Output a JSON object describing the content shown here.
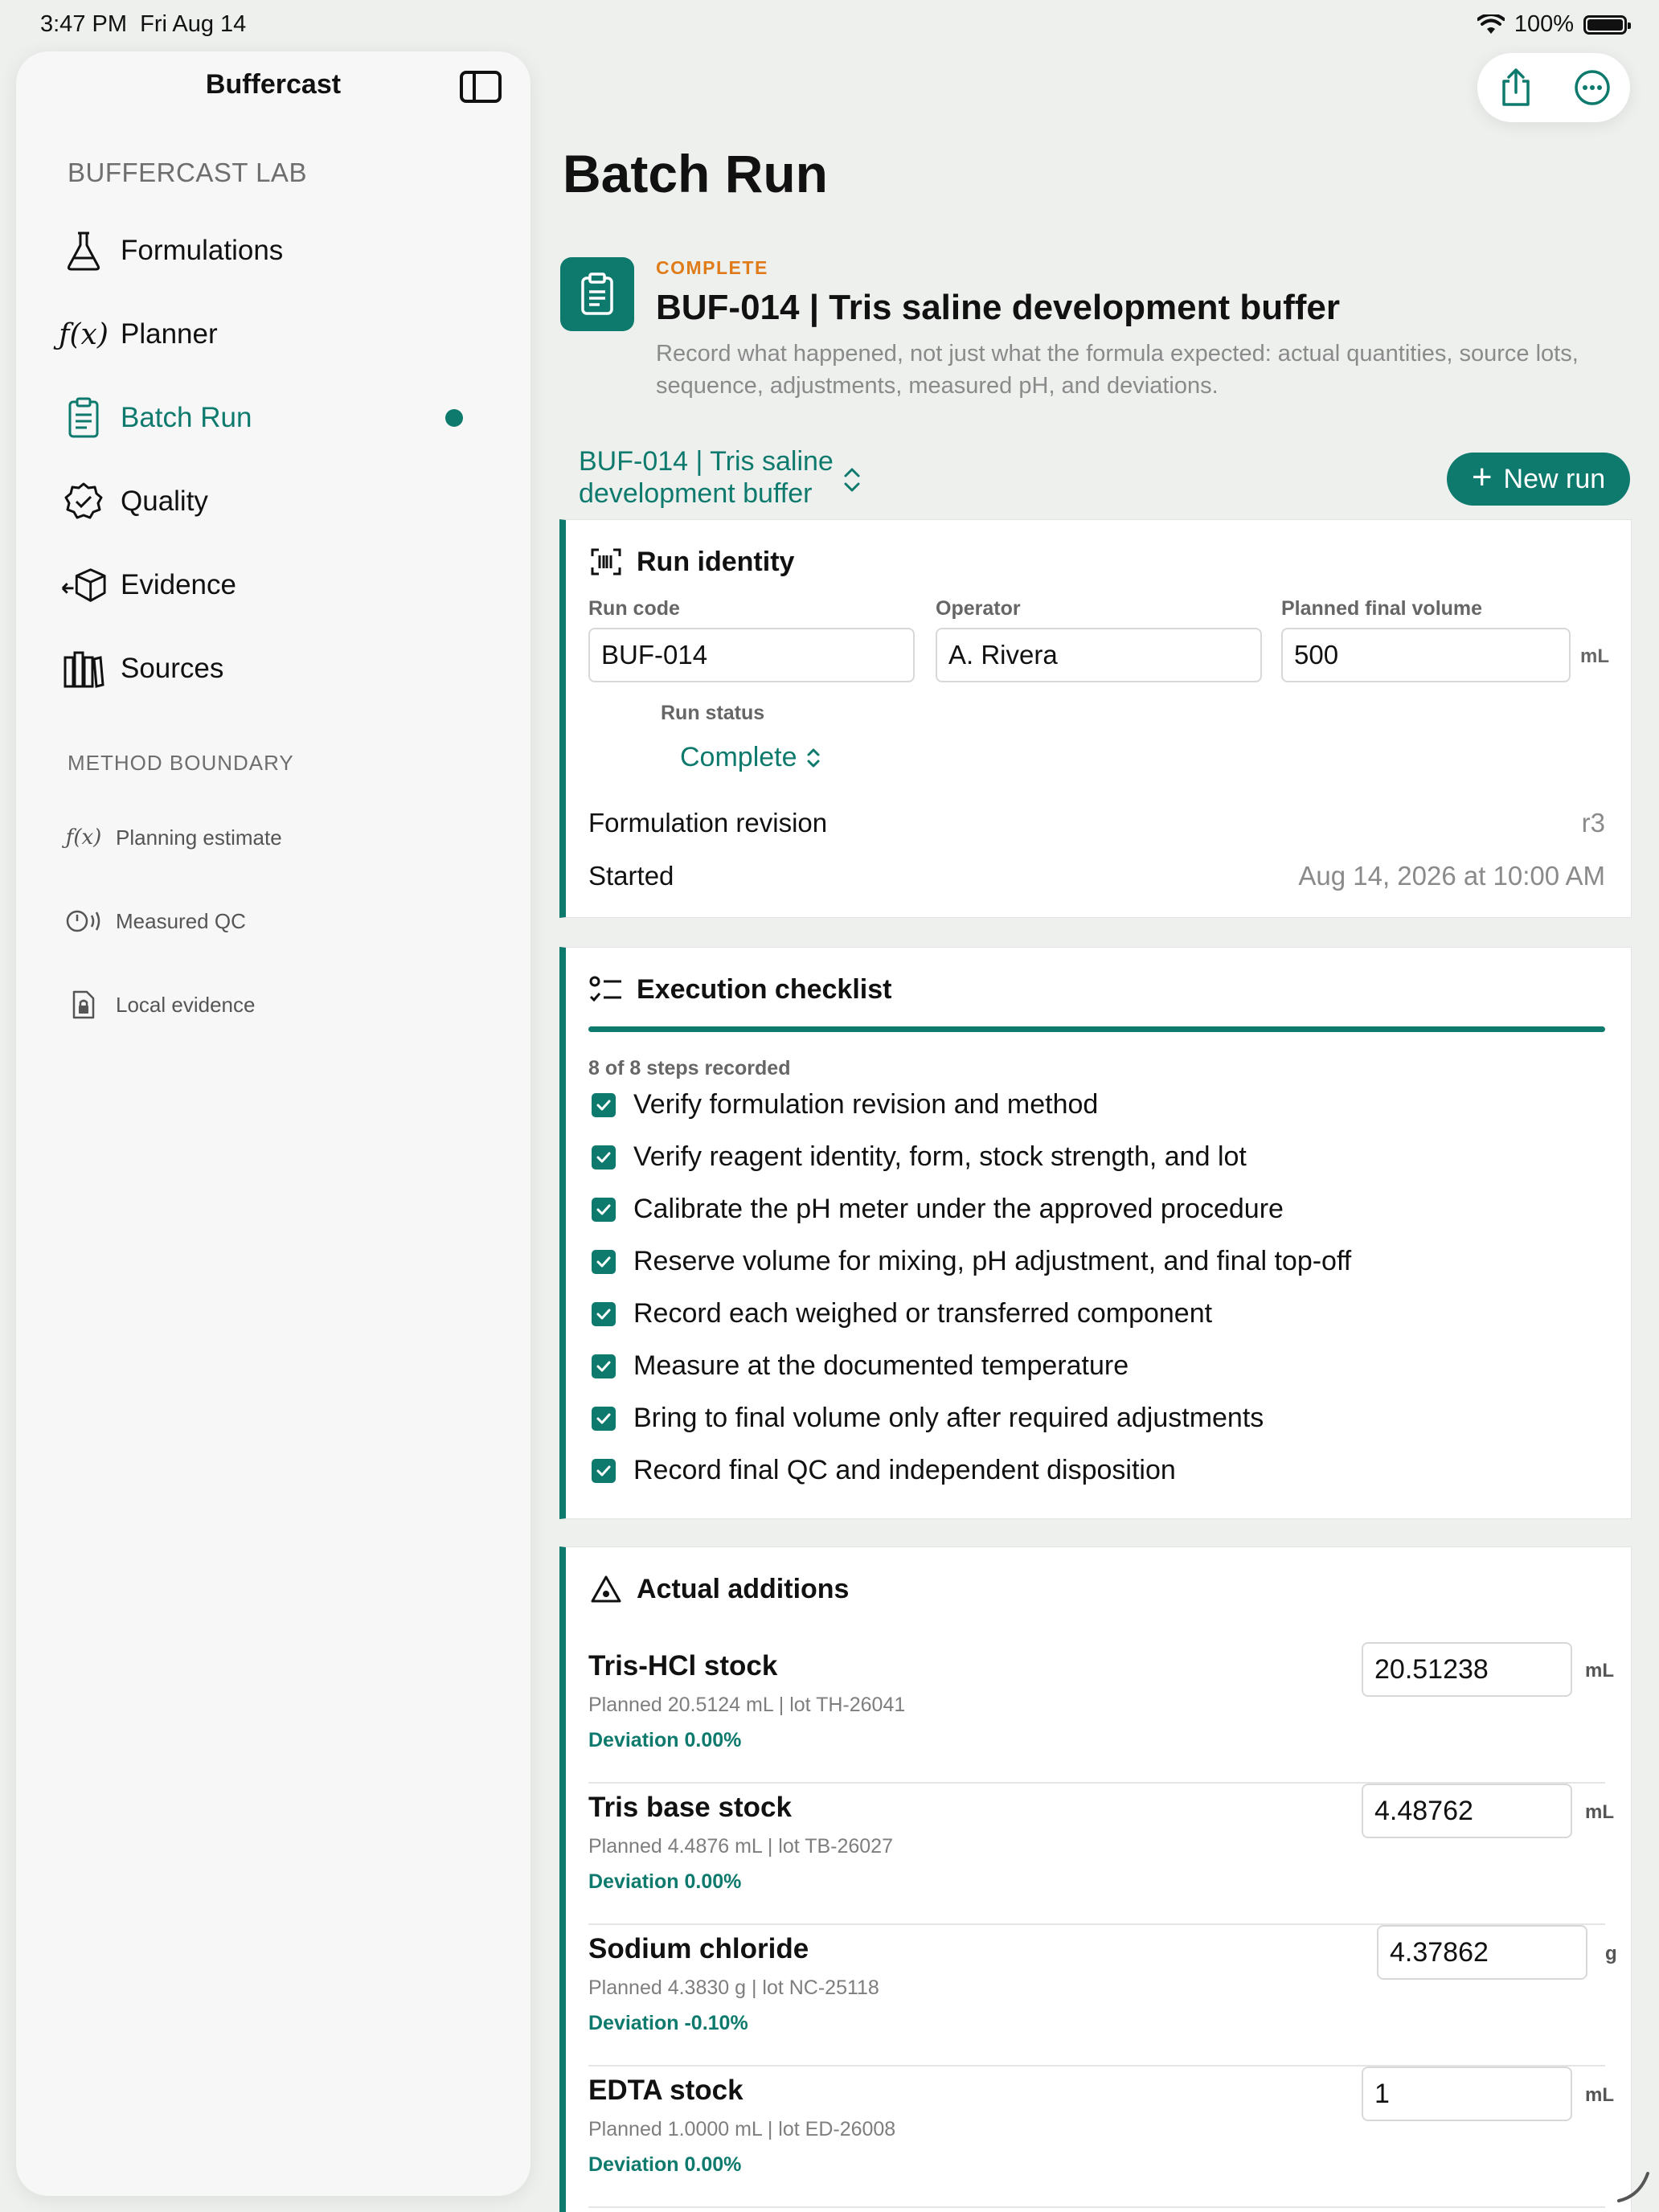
{
  "status_bar": {
    "time": "3:47 PM",
    "date": "Fri Aug 14",
    "battery": "100%"
  },
  "sidebar": {
    "title": "Buffercast",
    "section": "BUFFERCAST LAB",
    "items": [
      {
        "label": "Formulations",
        "icon": "flask-icon"
      },
      {
        "label": "Planner",
        "icon": "function-icon"
      },
      {
        "label": "Batch Run",
        "icon": "clipboard-icon",
        "active": true
      },
      {
        "label": "Quality",
        "icon": "seal-check-icon"
      },
      {
        "label": "Evidence",
        "icon": "box-icon"
      },
      {
        "label": "Sources",
        "icon": "books-icon"
      }
    ],
    "boundary_section": "METHOD BOUNDARY",
    "boundary_items": [
      {
        "label": "Planning estimate",
        "icon": "function-icon"
      },
      {
        "label": "Measured QC",
        "icon": "gauge-icon"
      },
      {
        "label": "Local evidence",
        "icon": "locked-doc-icon"
      }
    ]
  },
  "page": {
    "title": "Batch Run",
    "status": "COMPLETE",
    "name": "BUF-014 | Tris saline development buffer",
    "description": "Record what happened, not just what the formula expected: actual quantities, source lots, sequence, adjustments, measured pH, and deviations.",
    "picker_label": "BUF-014 | Tris saline development buffer",
    "new_run_label": "New run"
  },
  "run_identity": {
    "title": "Run identity",
    "run_code_label": "Run code",
    "run_code": "BUF-014",
    "operator_label": "Operator",
    "operator": "A. Rivera",
    "volume_label": "Planned final volume",
    "volume": "500",
    "volume_unit": "mL",
    "status_label": "Run status",
    "status_value": "Complete",
    "revision_label": "Formulation revision",
    "revision_value": "r3",
    "started_label": "Started",
    "started_value": "Aug 14, 2026 at 10:00 AM"
  },
  "checklist": {
    "title": "Execution checklist",
    "count_text": "8 of 8 steps recorded",
    "progress": 1.0,
    "steps": [
      "Verify formulation revision and method",
      "Verify reagent identity, form, stock strength, and lot",
      "Calibrate the pH meter under the approved procedure",
      "Reserve volume for mixing, pH adjustment, and final top-off",
      "Record each weighed or transferred component",
      "Measure at the documented temperature",
      "Bring to final volume only after required adjustments",
      "Record final QC and independent disposition"
    ]
  },
  "additions": {
    "title": "Actual additions",
    "rows": [
      {
        "name": "Tris-HCl stock",
        "planned": "Planned 20.5124 mL | lot TH-26041",
        "deviation": "Deviation 0.00%",
        "value": "20.51238",
        "unit": "mL"
      },
      {
        "name": "Tris base stock",
        "planned": "Planned 4.4876 mL | lot TB-26027",
        "deviation": "Deviation 0.00%",
        "value": "4.48762",
        "unit": "mL"
      },
      {
        "name": "Sodium chloride",
        "planned": "Planned 4.3830 g | lot NC-25118",
        "deviation": "Deviation -0.10%",
        "value": "4.37862",
        "unit": "g"
      },
      {
        "name": "EDTA stock",
        "planned": "Planned 1.0000 mL | lot ED-26008",
        "deviation": "Deviation 0.00%",
        "value": "1",
        "unit": "mL"
      }
    ]
  },
  "colors": {
    "accent": "#0e7a6d",
    "status": "#e07b1a"
  }
}
